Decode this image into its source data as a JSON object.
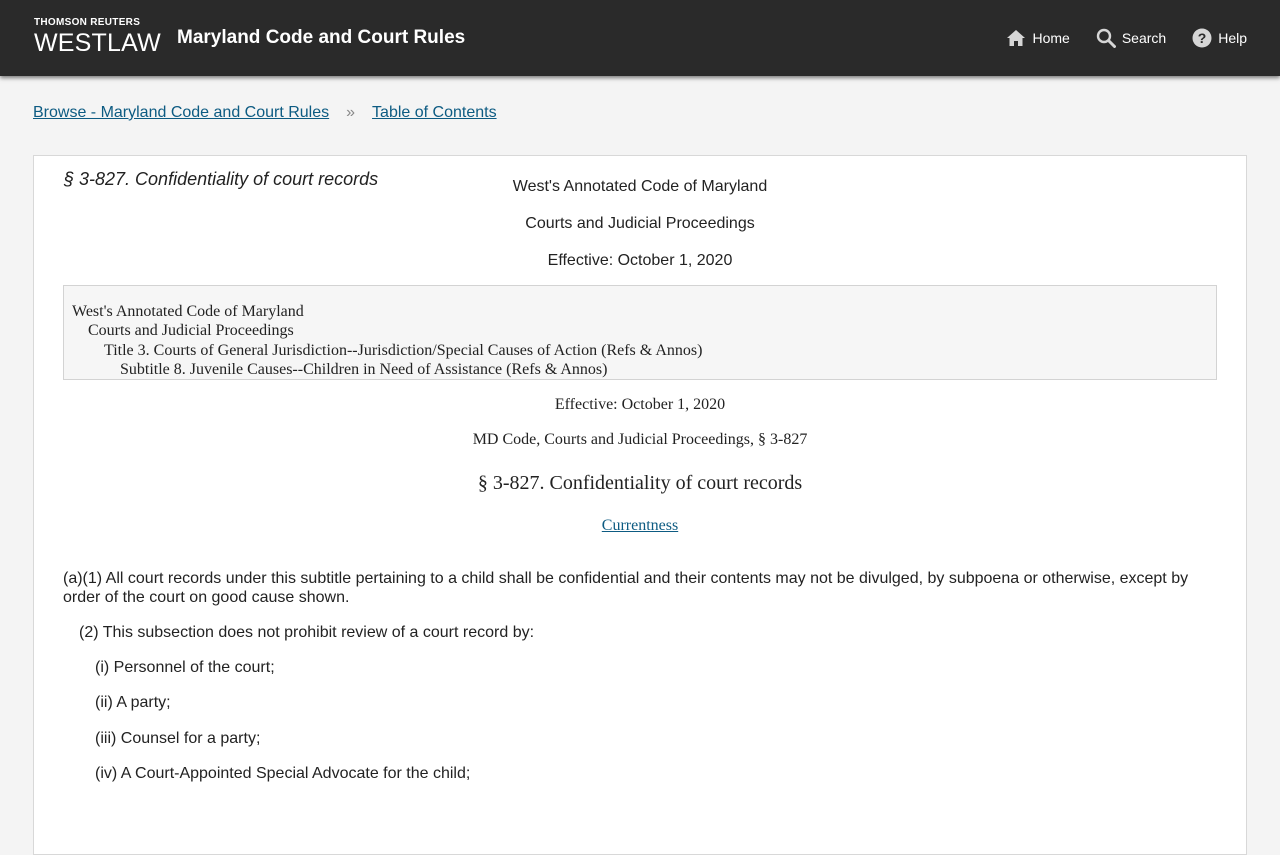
{
  "header": {
    "brand_top": "THOMSON REUTERS",
    "brand_main": "WESTLAW",
    "app_title": "Maryland Code and Court Rules",
    "nav": [
      {
        "label": "Home",
        "icon": "home-icon"
      },
      {
        "label": "Search",
        "icon": "search-icon"
      },
      {
        "label": "Help",
        "icon": "help-icon"
      }
    ]
  },
  "breadcrumb": {
    "items": [
      "Browse - Maryland Code and Court Rules",
      "Table of Contents"
    ],
    "separator": "»"
  },
  "document": {
    "heading": "§ 3-827. Confidentiality of court records",
    "source": "West's Annotated Code of Maryland",
    "subject": "Courts and Judicial Proceedings",
    "effective_top": "Effective: October 1, 2020",
    "toc": [
      "West's Annotated Code of Maryland",
      "Courts and Judicial Proceedings",
      "Title 3. Courts of General Jurisdiction--Jurisdiction/Special Causes of Action (Refs & Annos)",
      "Subtitle 8. Juvenile Causes--Children in Need of Assistance (Refs & Annos)"
    ],
    "effective": "Effective: October 1, 2020",
    "citation": "MD Code, Courts and Judicial Proceedings, § 3-827",
    "section_title": "§ 3-827. Confidentiality of court records",
    "currentness_link": "Currentness",
    "paragraphs": [
      "(a)(1) All court records under this subtitle pertaining to a child shall be confidential and their contents may not be divulged, by subpoena or otherwise, except by order of the court on good cause shown.",
      "(2) This subsection does not prohibit review of a court record by:",
      "(i) Personnel of the court;",
      "(ii) A party;",
      "(iii) Counsel for a party;",
      "(iv) A Court-Appointed Special Advocate for the child;"
    ]
  },
  "colors": {
    "header_bg": "#2a2a2a",
    "link": "#0d5b82",
    "page_bg": "#f4f4f4"
  }
}
